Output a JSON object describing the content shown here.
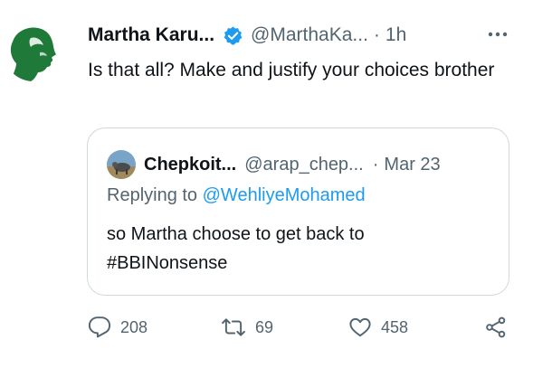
{
  "tweet": {
    "author_name": "Martha Karu...",
    "author_handle": "@MarthaKa...",
    "separator": "·",
    "time": "1h",
    "text": "Is that all? Make and justify your choices brother",
    "more_label": "···"
  },
  "quoted_tweet": {
    "author_name": "Chepkoit...",
    "author_handle": "@arap_chep...",
    "separator": "·",
    "date": "Mar 23",
    "replying_prefix": "Replying to",
    "replying_to": "@WehliyeMohamed",
    "text_line1": "so Martha choose to get back to",
    "text_line2": "#BBINonsense"
  },
  "actions": {
    "replies": "208",
    "retweets": "69",
    "likes": "458"
  },
  "colors": {
    "accent": "#1d9bf0",
    "secondary_text": "#536471",
    "avatar_green": "#1f7a3a",
    "border": "#cfd9de"
  },
  "icons": [
    "verified-badge-icon",
    "more-options-icon",
    "reply-icon",
    "retweet-icon",
    "like-icon",
    "share-icon"
  ]
}
